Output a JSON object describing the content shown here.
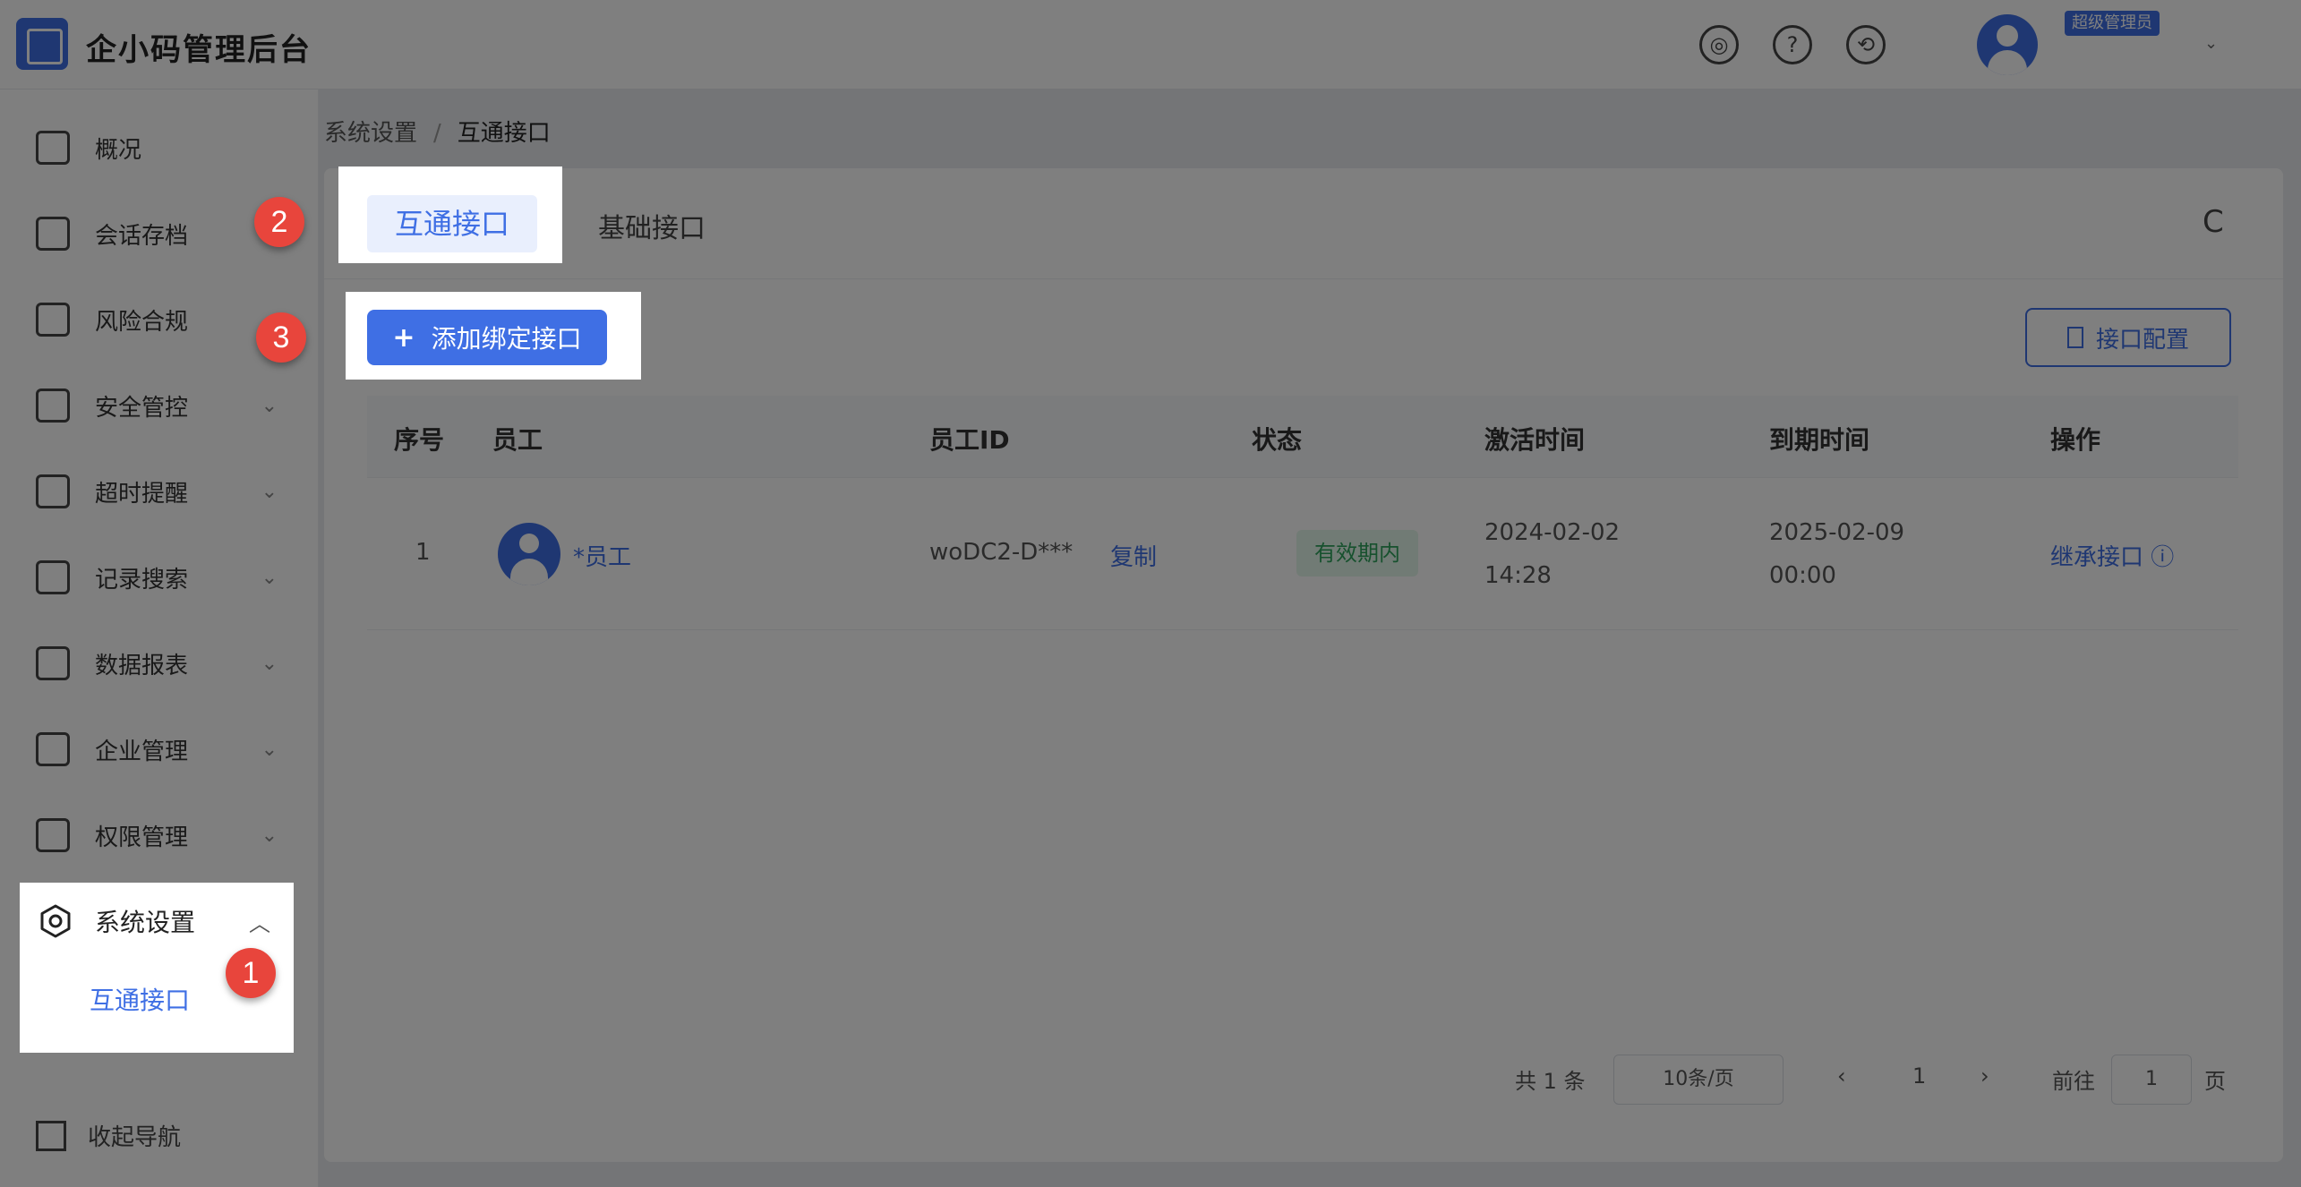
{
  "app": {
    "title": "企小码管理后台",
    "role_badge": "超级管理员"
  },
  "header_icons": [
    {
      "name": "compass-icon",
      "glyph": "◎"
    },
    {
      "name": "help-icon",
      "glyph": "?"
    },
    {
      "name": "sync-icon",
      "glyph": "⟲"
    }
  ],
  "sidebar": {
    "items": [
      {
        "label": "概况",
        "has_children": false
      },
      {
        "label": "会话存档",
        "has_children": false
      },
      {
        "label": "风险合规",
        "has_children": false
      },
      {
        "label": "安全管控",
        "has_children": true
      },
      {
        "label": "超时提醒",
        "has_children": true
      },
      {
        "label": "记录搜索",
        "has_children": true
      },
      {
        "label": "数据报表",
        "has_children": true
      },
      {
        "label": "企业管理",
        "has_children": true
      },
      {
        "label": "权限管理",
        "has_children": true
      }
    ],
    "system_settings": {
      "label": "系统设置",
      "sub_items": [
        "互通接口"
      ]
    },
    "collapse_label": "收起导航"
  },
  "breadcrumb": {
    "parent": "系统设置",
    "sep": "/",
    "current": "互通接口"
  },
  "tabs": [
    {
      "label": "互通接口",
      "active": true
    },
    {
      "label": "基础接口",
      "active": false
    }
  ],
  "toolbar": {
    "add_label": "添加绑定接口",
    "add_icon": "+",
    "config_label": "接口配置",
    "refresh_icon": "C"
  },
  "table": {
    "headers": [
      "序号",
      "员工",
      "员工ID",
      "状态",
      "激活时间",
      "到期时间",
      "操作"
    ],
    "rows": [
      {
        "index": "1",
        "employee": "*员工",
        "employee_id": "woDC2-D***",
        "copy_label": "复制",
        "status": "有效期内",
        "activated_date": "2024-02-02",
        "activated_time": "14:28",
        "expire_date": "2025-02-09",
        "expire_time": "00:00",
        "action": "继承接口 ⓘ"
      }
    ]
  },
  "pagination": {
    "total": "共 1 条",
    "page_size": "10条/页",
    "prev": "‹",
    "current_page": "1",
    "next": "›",
    "goto_label": "前往",
    "goto_value": "1",
    "goto_suffix": "页"
  },
  "markers": [
    "1",
    "2",
    "3"
  ],
  "colors": {
    "primary": "#3f6fe4",
    "marker": "#e8453c",
    "success": "#2fa35c",
    "overlay": "rgba(0,0,0,0.5)"
  }
}
